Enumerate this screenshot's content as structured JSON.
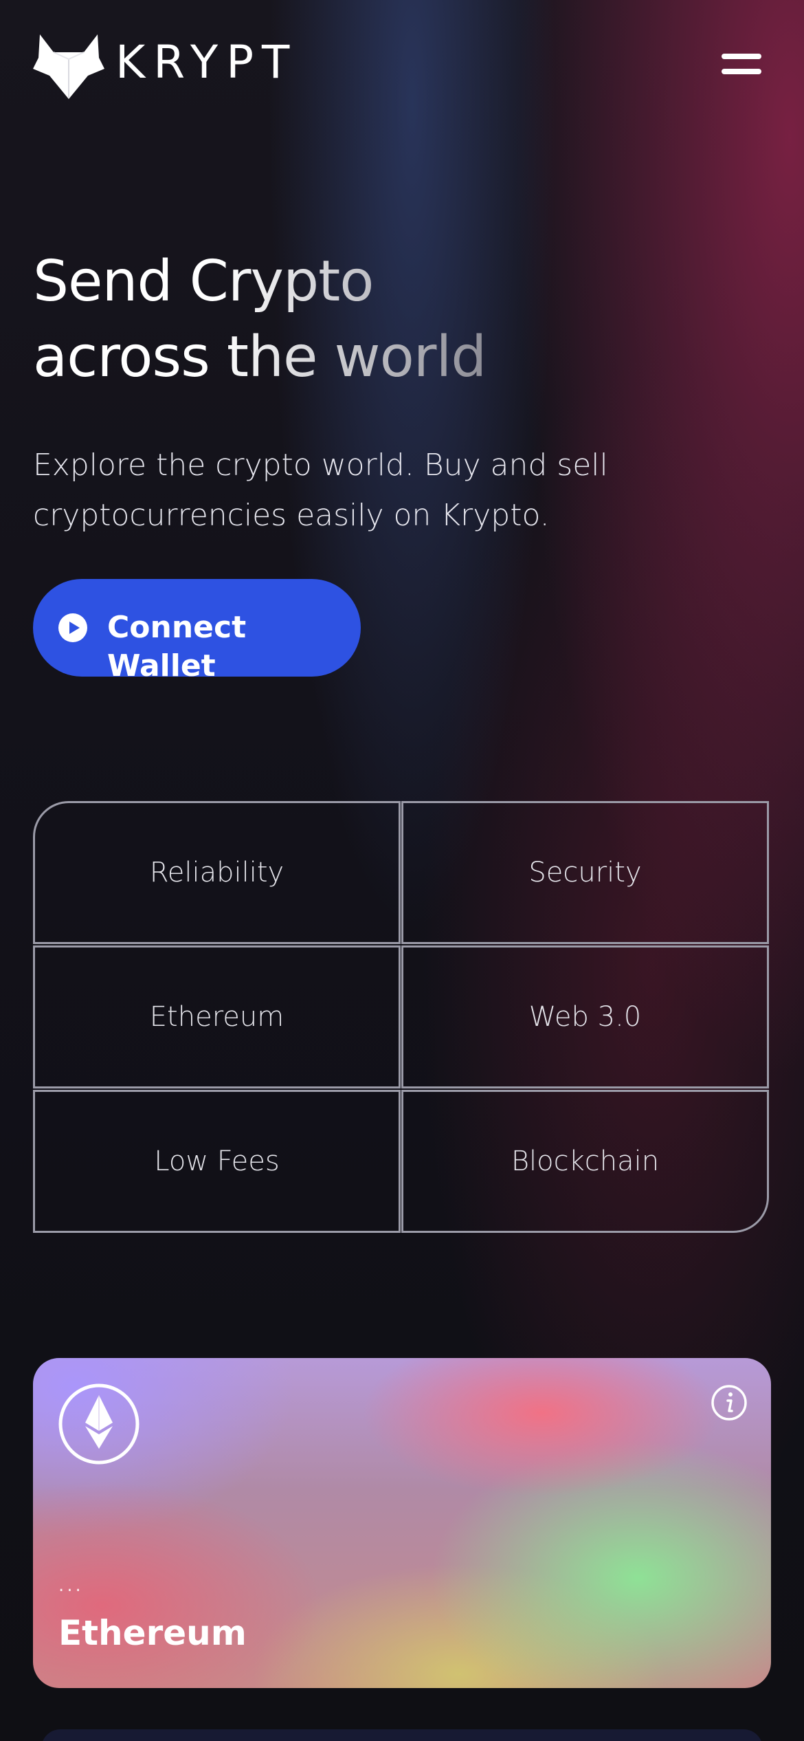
{
  "brand": {
    "name": "KRYPT",
    "logo_icon": "fox-head-icon"
  },
  "header": {
    "menu_icon": "hamburger-menu-icon"
  },
  "hero": {
    "title_line1": "Send Crypto",
    "title_line2": "across the world",
    "subtitle": "Explore the crypto world. Buy and sell cryptocurrencies easily on Krypto.",
    "cta_label": "Connect Wallet",
    "cta_icon": "play-circle-icon",
    "cta_color": "#2e52e2"
  },
  "features": [
    "Reliability",
    "Security",
    "Ethereum",
    "Web 3.0",
    "Low Fees",
    "Blockchain"
  ],
  "eth_card": {
    "icon": "ethereum-icon",
    "info_icon": "info-icon",
    "address": "...",
    "name": "Ethereum"
  },
  "colors": {
    "background": "#0f0f14",
    "accent_blue": "#2e52e2",
    "accent_red": "#822246",
    "grid_border": "#9b9ba8"
  }
}
